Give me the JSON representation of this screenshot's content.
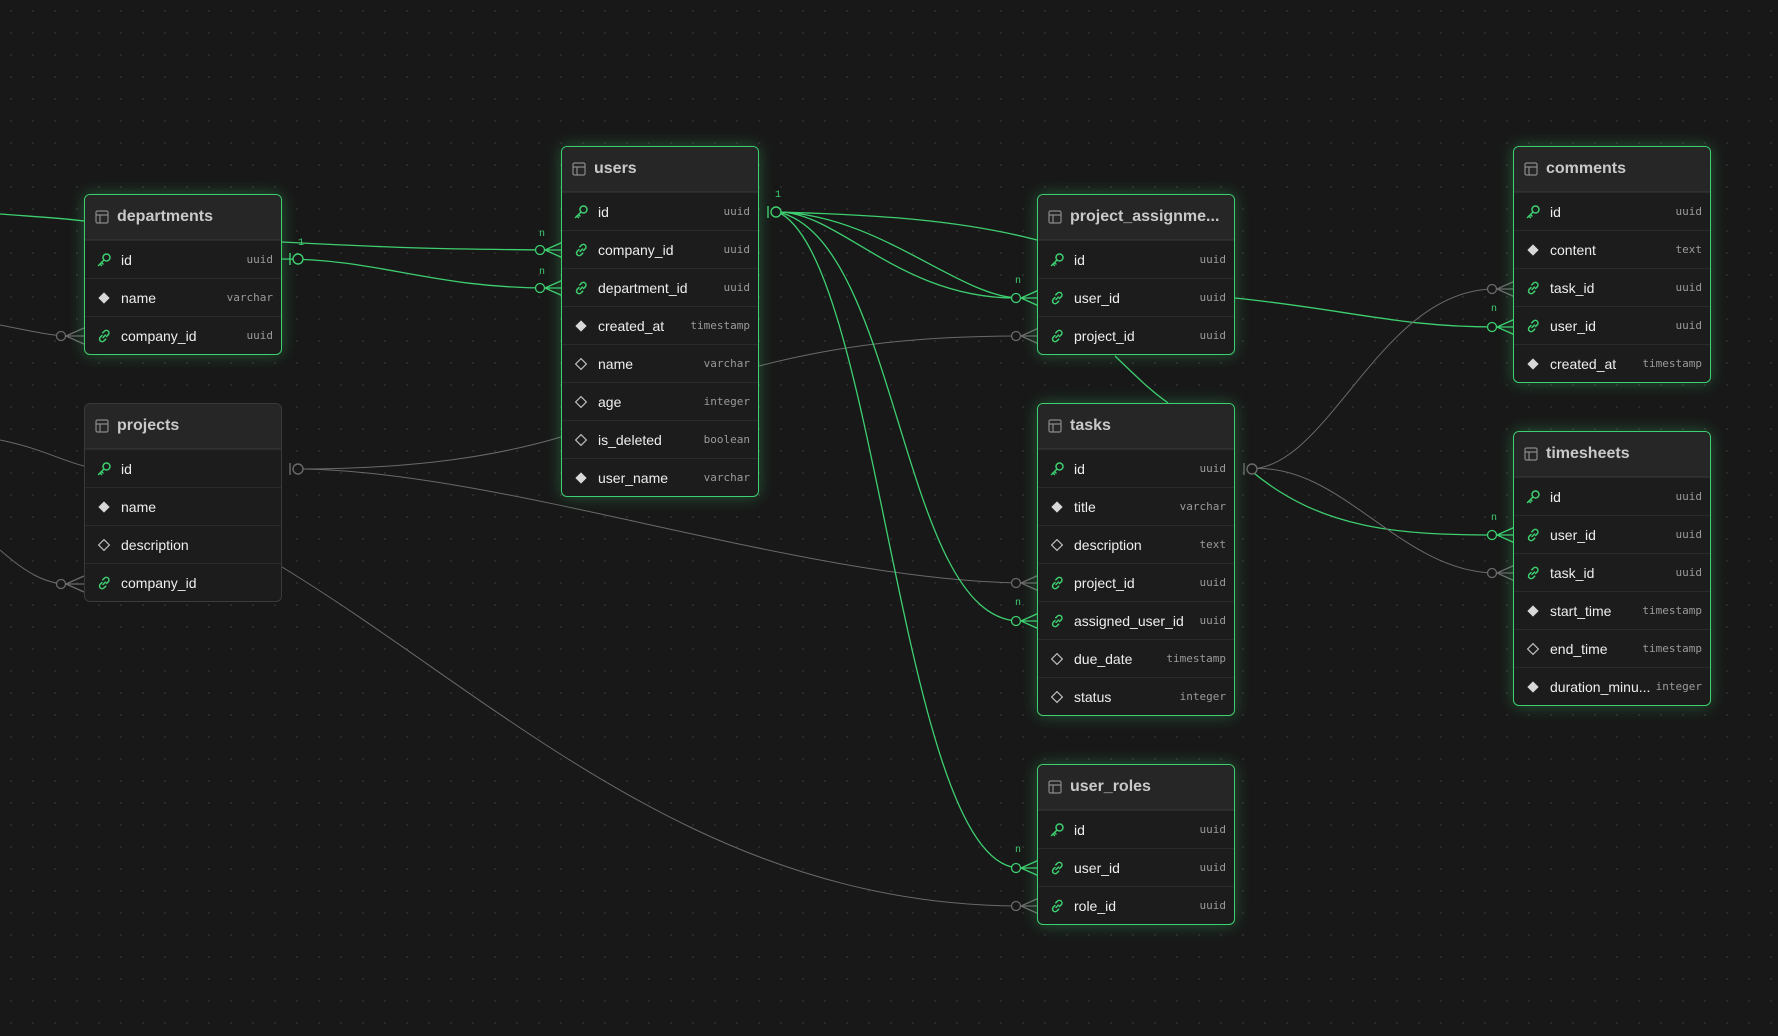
{
  "colors": {
    "accent": "#3ecf70",
    "muted": "#6a6a6a",
    "background": "#181818"
  },
  "tables": [
    {
      "title": "departments",
      "highlighted": true,
      "columns": [
        {
          "name": "id",
          "type": "uuid",
          "icon": "key-icon"
        },
        {
          "name": "name",
          "type": "varchar",
          "icon": "diamond-filled-icon"
        },
        {
          "name": "company_id",
          "type": "uuid",
          "icon": "link-icon"
        }
      ]
    },
    {
      "title": "projects",
      "highlighted": false,
      "columns": [
        {
          "name": "id",
          "type": "",
          "icon": "key-icon"
        },
        {
          "name": "name",
          "type": "",
          "icon": "diamond-filled-icon"
        },
        {
          "name": "description",
          "type": "",
          "icon": "diamond-outline-icon"
        },
        {
          "name": "company_id",
          "type": "",
          "icon": "link-icon"
        }
      ]
    },
    {
      "title": "users",
      "highlighted": true,
      "columns": [
        {
          "name": "id",
          "type": "uuid",
          "icon": "key-icon"
        },
        {
          "name": "company_id",
          "type": "uuid",
          "icon": "link-icon"
        },
        {
          "name": "department_id",
          "type": "uuid",
          "icon": "link-icon"
        },
        {
          "name": "created_at",
          "type": "timestamp",
          "icon": "diamond-filled-icon"
        },
        {
          "name": "name",
          "type": "varchar",
          "icon": "diamond-outline-icon"
        },
        {
          "name": "age",
          "type": "integer",
          "icon": "diamond-outline-icon"
        },
        {
          "name": "is_deleted",
          "type": "boolean",
          "icon": "diamond-outline-icon"
        },
        {
          "name": "user_name",
          "type": "varchar",
          "icon": "diamond-filled-icon"
        }
      ]
    },
    {
      "title": "project_assignme...",
      "highlighted": true,
      "columns": [
        {
          "name": "id",
          "type": "uuid",
          "icon": "key-icon"
        },
        {
          "name": "user_id",
          "type": "uuid",
          "icon": "link-icon"
        },
        {
          "name": "project_id",
          "type": "uuid",
          "icon": "link-icon"
        }
      ]
    },
    {
      "title": "tasks",
      "highlighted": true,
      "columns": [
        {
          "name": "id",
          "type": "uuid",
          "icon": "key-icon"
        },
        {
          "name": "title",
          "type": "varchar",
          "icon": "diamond-filled-icon"
        },
        {
          "name": "description",
          "type": "text",
          "icon": "diamond-outline-icon"
        },
        {
          "name": "project_id",
          "type": "uuid",
          "icon": "link-icon"
        },
        {
          "name": "assigned_user_id",
          "type": "uuid",
          "icon": "link-icon"
        },
        {
          "name": "due_date",
          "type": "timestamp",
          "icon": "diamond-outline-icon"
        },
        {
          "name": "status",
          "type": "integer",
          "icon": "diamond-outline-icon"
        }
      ]
    },
    {
      "title": "user_roles",
      "highlighted": true,
      "columns": [
        {
          "name": "id",
          "type": "uuid",
          "icon": "key-icon"
        },
        {
          "name": "user_id",
          "type": "uuid",
          "icon": "link-icon"
        },
        {
          "name": "role_id",
          "type": "uuid",
          "icon": "link-icon"
        }
      ]
    },
    {
      "title": "comments",
      "highlighted": true,
      "columns": [
        {
          "name": "id",
          "type": "uuid",
          "icon": "key-icon"
        },
        {
          "name": "content",
          "type": "text",
          "icon": "diamond-filled-icon"
        },
        {
          "name": "task_id",
          "type": "uuid",
          "icon": "link-icon"
        },
        {
          "name": "user_id",
          "type": "uuid",
          "icon": "link-icon"
        },
        {
          "name": "created_at",
          "type": "timestamp",
          "icon": "diamond-filled-icon"
        }
      ]
    },
    {
      "title": "timesheets",
      "highlighted": true,
      "columns": [
        {
          "name": "id",
          "type": "uuid",
          "icon": "key-icon"
        },
        {
          "name": "user_id",
          "type": "uuid",
          "icon": "link-icon"
        },
        {
          "name": "task_id",
          "type": "uuid",
          "icon": "link-icon"
        },
        {
          "name": "start_time",
          "type": "timestamp",
          "icon": "diamond-filled-icon"
        },
        {
          "name": "end_time",
          "type": "timestamp",
          "icon": "diamond-outline-icon"
        },
        {
          "name": "duration_minu...",
          "type": "integer",
          "icon": "diamond-filled-icon"
        }
      ]
    }
  ],
  "cardinality": {
    "one": "1",
    "many": "n"
  }
}
